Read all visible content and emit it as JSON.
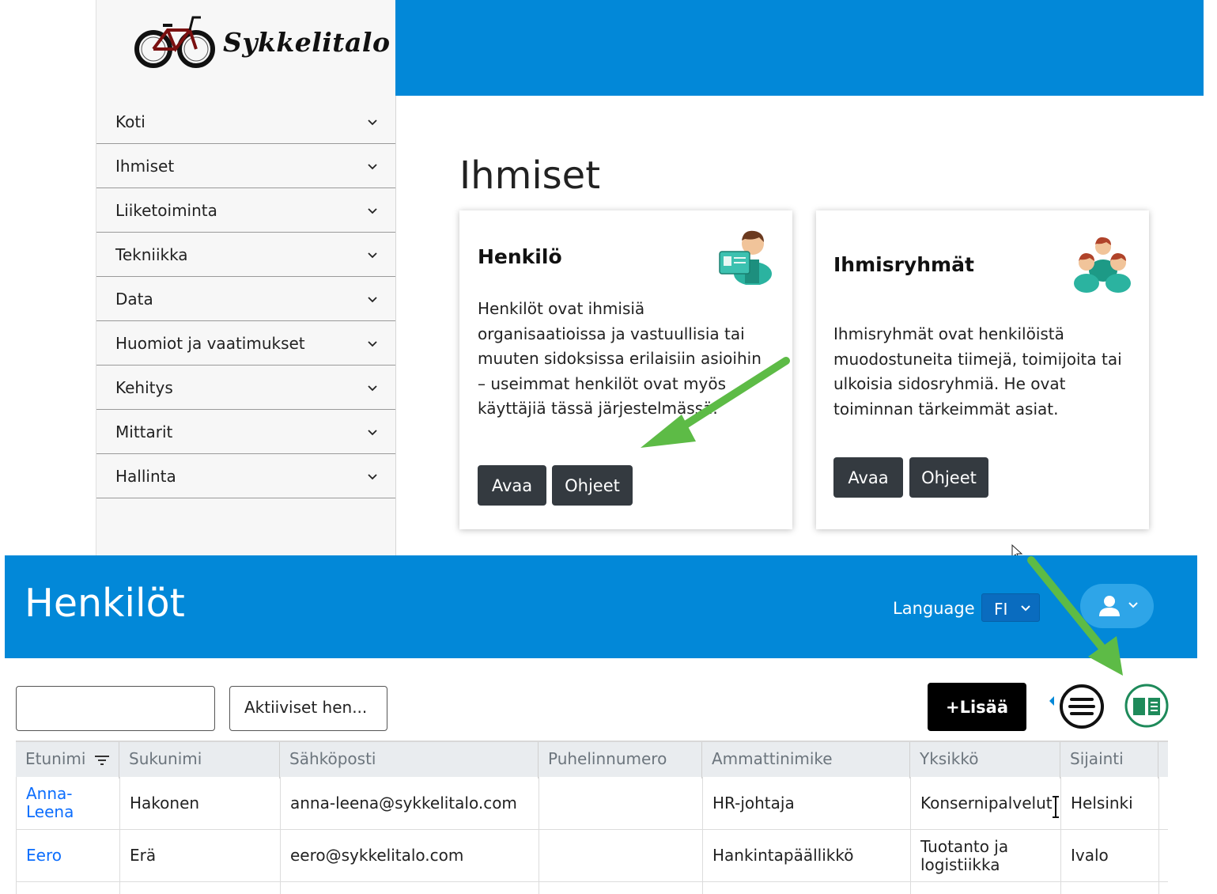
{
  "brand": {
    "name": "Sykkelitalo"
  },
  "sidebar": {
    "items": [
      {
        "label": "Koti"
      },
      {
        "label": "Ihmiset"
      },
      {
        "label": "Liiketoiminta"
      },
      {
        "label": "Tekniikka"
      },
      {
        "label": "Data"
      },
      {
        "label": "Huomiot ja vaatimukset"
      },
      {
        "label": "Kehitys"
      },
      {
        "label": "Mittarit"
      },
      {
        "label": "Hallinta"
      }
    ]
  },
  "main": {
    "title": "Ihmiset",
    "cards": [
      {
        "title": "Henkilö",
        "icon": "person-card-icon",
        "description": "Henkilöt ovat ihmisiä organisaatioissa ja vastuullisia tai muuten sidoksissa erilaisiin asioihin – useimmat henkilöt ovat myös käyttäjiä tässä järjestelmässä.",
        "open_label": "Avaa",
        "help_label": "Ohjeet"
      },
      {
        "title": "Ihmisryhmät",
        "icon": "people-group-icon",
        "description": "Ihmisryhmät ovat henkilöistä muodostuneita tiimejä, toimijoita tai ulkoisia sidosryhmiä. He ovat toiminnan tärkeimmät asiat.",
        "open_label": "Avaa",
        "help_label": "Ohjeet"
      }
    ]
  },
  "persons": {
    "title": "Henkilöt",
    "language_label": "Language",
    "language_value": "FI",
    "search_value": "",
    "filter_label": "Aktiiviset hen...",
    "add_label": "+Lisää",
    "columns": [
      "Etunimi",
      "Sukunimi",
      "Sähköposti",
      "Puhelinnumero",
      "Ammattinimike",
      "Yksikkö",
      "Sijainti"
    ],
    "rows": [
      {
        "first": "Anna-\nLeena",
        "last": "Hakonen",
        "email": "anna-leena@sykkelitalo.com",
        "phone": "",
        "title": "HR-johtaja",
        "unit": "Konsernipalvelut",
        "location": "Helsinki"
      },
      {
        "first": "Eero",
        "last": "Erä",
        "email": "eero@sykkelitalo.com",
        "phone": "",
        "title": "Hankintapäällikkö",
        "unit": "Tuotanto ja\nlogistiikka",
        "location": "Ivalo"
      }
    ]
  },
  "colors": {
    "header_blue": "#0288d8",
    "annotation_arrow": "#5dbb46",
    "button_dark": "#343a40",
    "book_green": "#1e8a5a"
  }
}
